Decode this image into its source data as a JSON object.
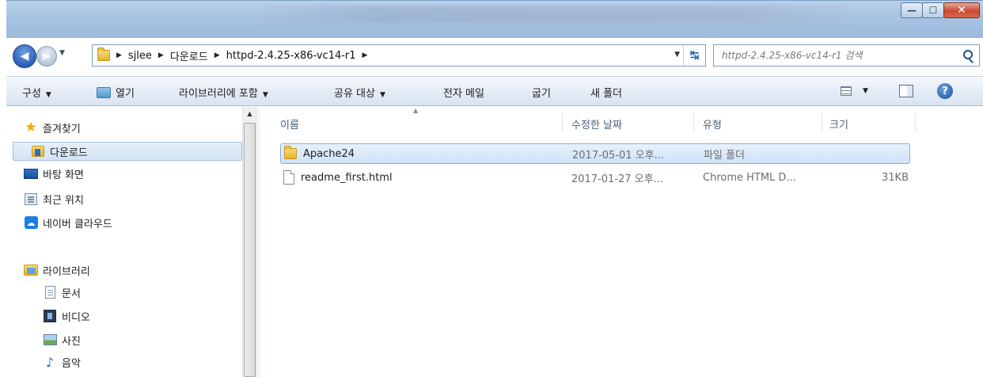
{
  "address": {
    "crumbs": [
      "sjlee",
      "다운로드",
      "httpd-2.4.25-x86-vc14-r1"
    ]
  },
  "search": {
    "placeholder": "httpd-2.4.25-x86-vc14-r1 검색"
  },
  "toolbar": {
    "organize": "구성",
    "open": "열기",
    "include_in_library": "라이브러리에 포함",
    "share_with": "공유 대상",
    "email": "전자 메일",
    "burn": "굽기",
    "new_folder": "새 폴더"
  },
  "nav": {
    "favorites": "즐겨찾기",
    "downloads": "다운로드",
    "desktop": "바탕 화면",
    "recent": "최근 위치",
    "naver_cloud": "네이버 클라우드",
    "libraries": "라이브러리",
    "documents": "문서",
    "videos": "비디오",
    "pictures": "사진",
    "music": "음악"
  },
  "columns": {
    "name": "이름",
    "modified": "수정한 날짜",
    "type": "유형",
    "size": "크기"
  },
  "files": [
    {
      "name": "Apache24",
      "modified": "2017-05-01 오후...",
      "type": "파일 폴더",
      "size": ""
    },
    {
      "name": "readme_first.html",
      "modified": "2017-01-27 오후...",
      "type": "Chrome HTML D...",
      "size": "31KB"
    }
  ],
  "colors": {
    "selection": "#cfe2f8",
    "selection_border": "#84acdd",
    "command_bar": "#e4ecf6"
  }
}
